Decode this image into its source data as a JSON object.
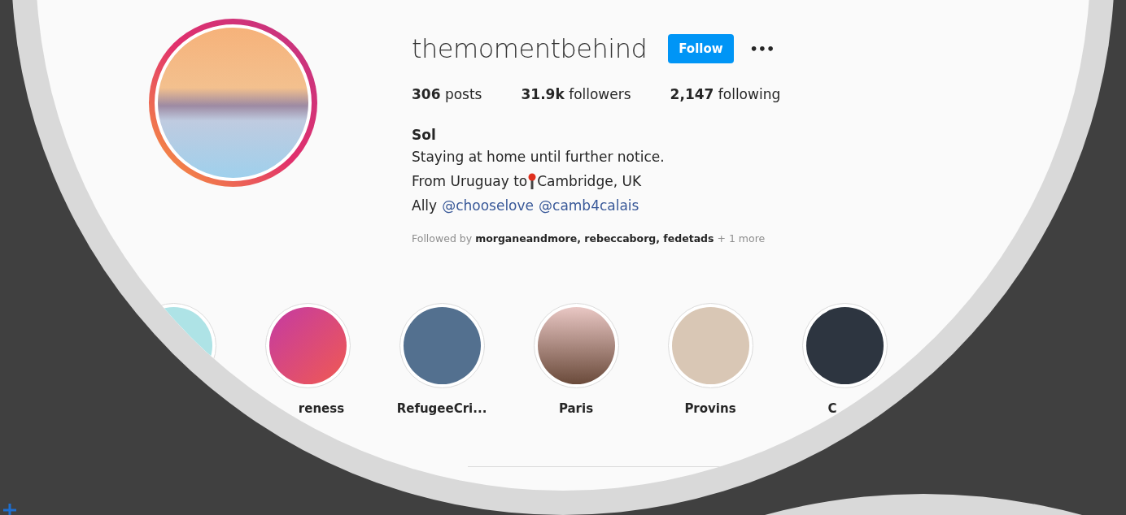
{
  "profile": {
    "username": "themomentbehind",
    "follow_button": "Follow",
    "more_button": "•••",
    "stats": [
      {
        "count": "306",
        "label": "posts"
      },
      {
        "count": "31.9k",
        "label": "followers"
      },
      {
        "count": "2,147",
        "label": "following"
      }
    ],
    "name": "Sol",
    "bio": [
      {
        "kind": "text",
        "text": "Staying at home until further notice."
      },
      {
        "kind": "pin",
        "before": "From Uruguay to",
        "after": "Cambridge, UK"
      },
      {
        "kind": "mentions",
        "text": "Ally",
        "mentions": [
          "@chooselove",
          "@camb4calais"
        ]
      }
    ],
    "followed_by": "Followed by **morganeandmore, rebeccaborg, fedetads** + 1 more"
  },
  "edge_highlight": true,
  "highlights": [
    {
      "label": "reness"
    },
    {
      "label": "RefugeeCri..."
    },
    {
      "label": "Paris"
    },
    {
      "label": "Provins"
    },
    {
      "label": "C"
    }
  ]
}
